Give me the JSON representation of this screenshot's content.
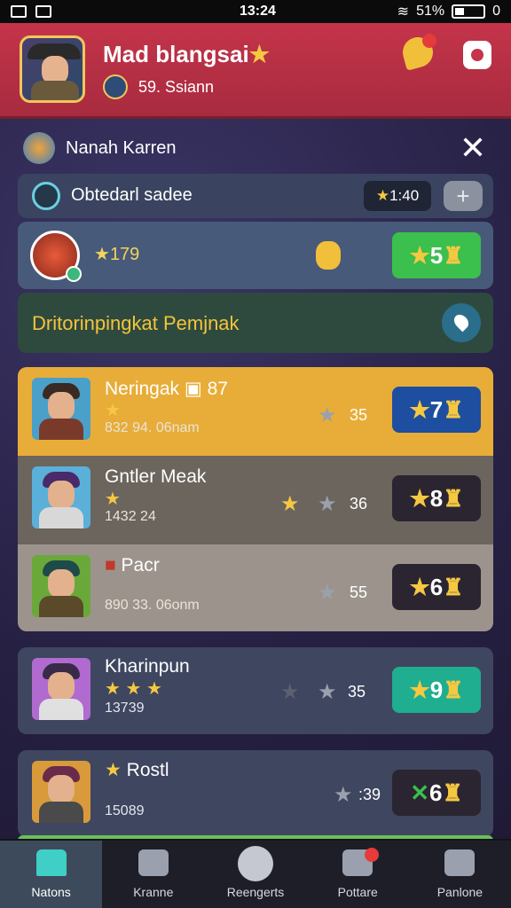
{
  "status_bar": {
    "time": "13:24",
    "battery": "51%",
    "extra": "0"
  },
  "header": {
    "title": "Mad blangsai",
    "subtitle": "59. Ssiann"
  },
  "panel": {
    "title": "Nanah Karren",
    "objective": {
      "label": "Obtedarl sadee",
      "pill": "1:40"
    },
    "player": {
      "score": "179",
      "action": "5"
    },
    "event": {
      "label": "Dritorinpingkat Pemjnak"
    }
  },
  "entries": [
    {
      "name": "Neringak",
      "level": "87",
      "stars": "★",
      "sub": "832 94. 06nam",
      "score": "35",
      "action": "7",
      "btn_color": "#1e4ea0"
    },
    {
      "name": "Gntler Meak",
      "stars": "★",
      "sub": "1432 24",
      "score": "36",
      "action": "8",
      "btn_color": "#2a2530"
    },
    {
      "name": "Pacr",
      "stars": "",
      "sub": "890 33. 06onm",
      "score": "55",
      "action": "6",
      "btn_color": "#2a2530"
    }
  ],
  "cards": [
    {
      "name": "Kharinpun",
      "stars": "★ ★ ★",
      "sub": "13739",
      "score": "35",
      "action": "9",
      "btn_color": "#1fae8f"
    },
    {
      "name": "Rostl",
      "stars": "★",
      "sub": "15089",
      "score": ":39",
      "action": "6",
      "btn_color": "#2a2530"
    }
  ],
  "nav": [
    {
      "label": "Natons"
    },
    {
      "label": "Kranne"
    },
    {
      "label": "Reengerts"
    },
    {
      "label": "Pottare"
    },
    {
      "label": "Panlone"
    }
  ]
}
